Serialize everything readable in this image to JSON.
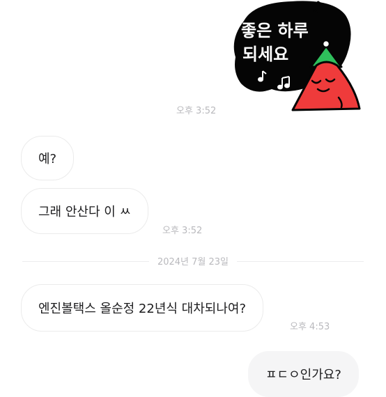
{
  "sticker": {
    "line1": "좋은 하루",
    "line2": "되세요",
    "colors": {
      "blob": "#050505",
      "triangle": "#ef3b3b",
      "hat": "#2fbf5c"
    }
  },
  "messages": [
    {
      "sender": "me",
      "kind": "sticker",
      "time": "오후 3:52"
    },
    {
      "sender": "other",
      "text": "예?"
    },
    {
      "sender": "other",
      "text": "그래 안산다 이 ㅆ",
      "time": "오후 3:52"
    },
    {
      "date": "2024년 7월 23일"
    },
    {
      "sender": "other",
      "text": "엔진볼택스 올순정 22년식 대차되나여?",
      "time": "오후 4:53"
    },
    {
      "sender": "me",
      "text": "ㅍㄷㅇ인가요?"
    }
  ]
}
